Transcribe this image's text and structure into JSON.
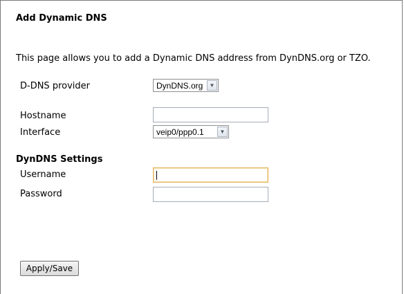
{
  "page": {
    "title": "Add Dynamic DNS",
    "description": "This page allows you to add a Dynamic DNS address from DynDNS.org or TZO."
  },
  "form": {
    "ddns_provider": {
      "label": "D-DNS provider",
      "value": "DynDNS.org"
    },
    "hostname": {
      "label": "Hostname",
      "value": ""
    },
    "interface": {
      "label": "Interface",
      "value": "veip0/ppp0.1"
    },
    "dyndns_settings": {
      "heading": "DynDNS Settings",
      "username": {
        "label": "Username",
        "value": ""
      },
      "password": {
        "label": "Password",
        "value": ""
      }
    }
  },
  "actions": {
    "apply_save_label": "Apply/Save"
  },
  "icons": {
    "dropdown": "chevron-down-icon"
  },
  "colors": {
    "focus_border": "#e2b45a",
    "input_border": "#a5acb5"
  }
}
